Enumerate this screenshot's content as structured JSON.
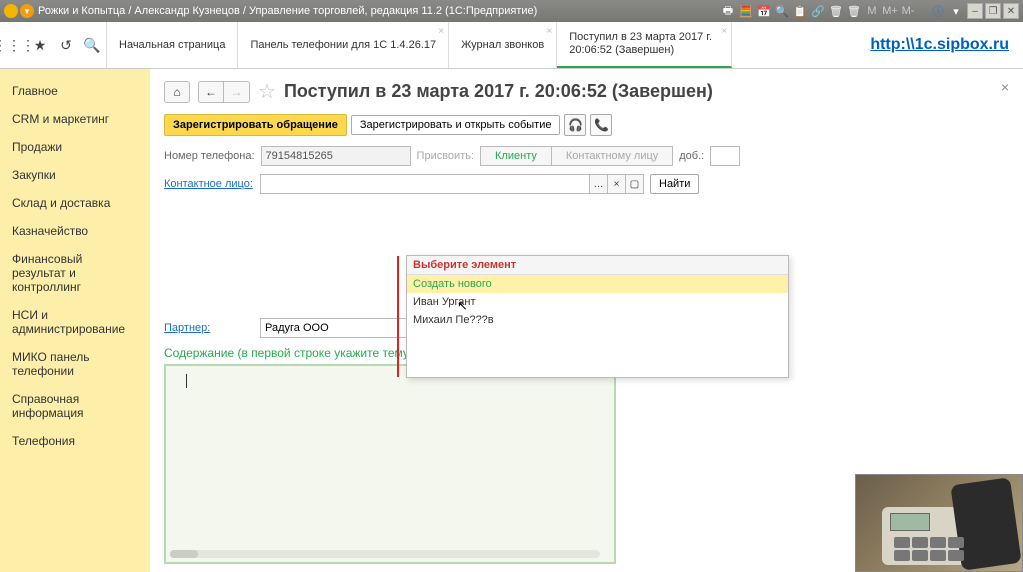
{
  "titlebar": {
    "title": "Рожки и Копытца / Александр Кузнецов / Управление торговлей, редакция 11.2  (1С:Предприятие)",
    "toolicons": [
      "print-icon",
      "calc-icon",
      "calendar-icon",
      "clipboard-icon",
      "mail-icon",
      "link-icon",
      "trash-icon",
      "trash2-icon"
    ],
    "mbuttons": [
      "M",
      "M+",
      "M-"
    ],
    "info": "ⓘ",
    "winbuttons": [
      "–",
      "❐",
      "✕"
    ]
  },
  "iconbar": {
    "apps": "⋮⋮⋮",
    "star": "★",
    "history": "↺",
    "search": "🔍"
  },
  "tabs": [
    {
      "label": "Начальная страница",
      "closable": false,
      "active": false
    },
    {
      "label": "Панель телефонии для 1С 1.4.26.17",
      "closable": true,
      "active": false
    },
    {
      "label": "Журнал звонков",
      "closable": true,
      "active": false
    },
    {
      "label": "Поступил в 23 марта 2017 г. 20:06:52 (Завершен)",
      "closable": true,
      "active": true
    }
  ],
  "toplink": "http:\\\\1c.sipbox.ru",
  "sidebar": [
    "Главное",
    "CRM и маркетинг",
    "Продажи",
    "Закупки",
    "Склад и доставка",
    "Казначейство",
    "Финансовый результат и контроллинг",
    "НСИ и администрирование",
    "МИКО панель телефонии",
    "Справочная информация",
    "Телефония"
  ],
  "page": {
    "home": "⌂",
    "back": "←",
    "fwd": "→",
    "star": "☆",
    "title": "Поступил в 23 марта 2017 г. 20:06:52 (Завершен)",
    "close": "×",
    "btn_register": "Зарегистрировать обращение",
    "btn_register_open": "Зарегистрировать и открыть событие",
    "icon_headset": "🎧",
    "icon_phone": "📞"
  },
  "form": {
    "phone_label": "Номер телефона:",
    "phone_value": "79154815265",
    "assign_label": "Присвоить:",
    "assign_client": "Клиенту",
    "assign_contact": "Контактному лицу",
    "ext_label": "доб.:",
    "ext_value": "",
    "contact_label": "Контактное лицо:",
    "contact_value": "",
    "find": "Найти",
    "dd_header": "Выберите элемент",
    "dd_create": "Создать нового",
    "dd_opts": [
      "Иван Ургант",
      "Михаил Пе???в"
    ],
    "partner_label": "Партнер:",
    "partner_value": "Радуга ООО",
    "content_label": "Содержание (в первой строке укажите тему обращения)"
  }
}
